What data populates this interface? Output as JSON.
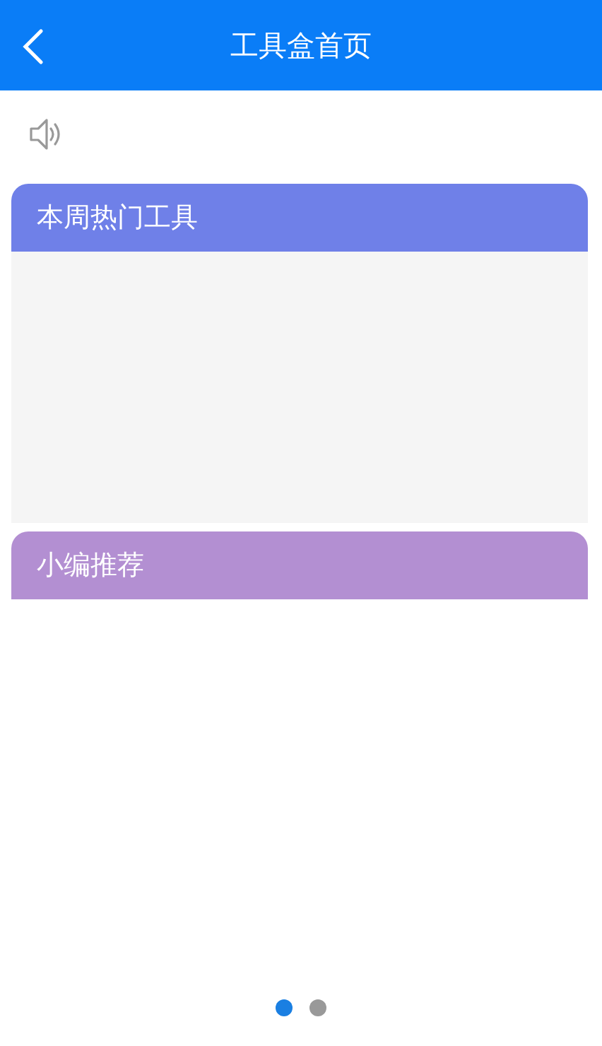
{
  "header": {
    "title": "工具盒首页"
  },
  "sections": [
    {
      "title": "本周热门工具",
      "color": "#6f80e8",
      "expanded": true
    },
    {
      "title": "小编推荐",
      "color": "#b38fd2",
      "expanded": false
    }
  ],
  "pager": [
    {
      "selected": true
    },
    {
      "selected": false
    }
  ]
}
